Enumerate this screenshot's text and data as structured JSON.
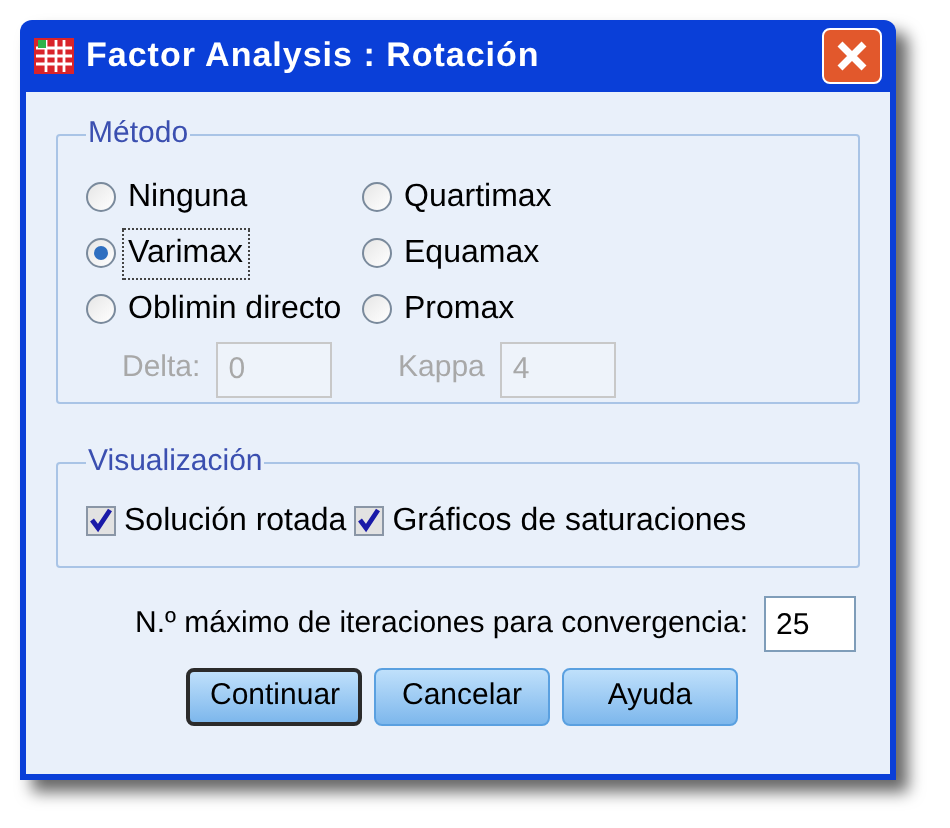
{
  "window": {
    "title": "Factor Analysis : Rotación"
  },
  "method_group": {
    "title": "Método",
    "options": [
      {
        "label": "Ninguna",
        "selected": false,
        "focused": false
      },
      {
        "label": "Quartimax",
        "selected": false,
        "focused": false
      },
      {
        "label": "Varimax",
        "selected": true,
        "focused": true
      },
      {
        "label": "Equamax",
        "selected": false,
        "focused": false
      },
      {
        "label": "Oblimin directo",
        "selected": false,
        "focused": false
      },
      {
        "label": "Promax",
        "selected": false,
        "focused": false
      }
    ],
    "params": [
      {
        "label": "Delta:",
        "value": "0",
        "disabled": true
      },
      {
        "label": "Kappa",
        "value": "4",
        "disabled": true
      }
    ]
  },
  "display_group": {
    "title": "Visualización",
    "checkboxes": [
      {
        "label": "Solución rotada",
        "checked": true
      },
      {
        "label": "Gráficos de saturaciones",
        "checked": true
      }
    ]
  },
  "iterations": {
    "label": "N.º máximo de iteraciones para convergencia:",
    "value": "25"
  },
  "buttons": [
    {
      "label": "Continuar",
      "default": true
    },
    {
      "label": "Cancelar",
      "default": false
    },
    {
      "label": "Ayuda",
      "default": false
    }
  ]
}
